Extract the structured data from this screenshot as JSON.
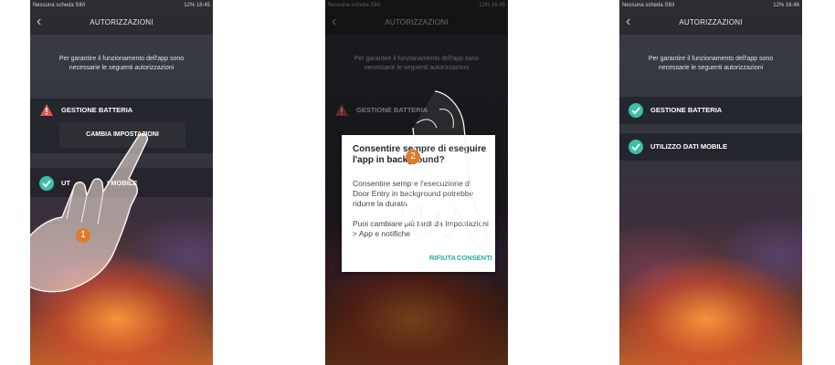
{
  "status_bar": {
    "left": "Nessuna scheda SIM",
    "right": "12%   16:45",
    "right_alt": "12%   16:46"
  },
  "header": {
    "title": "AUTORIZZAZIONI"
  },
  "intro": "Per garantire il funzionamento dell'app sono necessarie le seguenti autorizzazioni",
  "items": {
    "battery": "GESTIONE BATTERIA",
    "mobile_data": "UTILIZZO DATI MOBILE",
    "mobile_data_partial": "UT",
    "mobile_data_tail": "I MOBILE"
  },
  "change_settings_button": "CAMBIA IMPOSTAZIONI",
  "dialog": {
    "title": "Consentire sempre di eseguire l'app in background?",
    "body": "Consentire sempre l'esecuzione di Door Entry in background potrebbe ridurre la durata",
    "note": "Puoi cambiare più tardi da Impostazioni > App e notifiche",
    "deny": "RIFIUTA",
    "allow": "CONSENTI"
  },
  "steps": {
    "one": "1",
    "two": "2"
  },
  "colors": {
    "warning": "#e05a4f",
    "success": "#3bbfa8",
    "accent": "#2aa89a",
    "step_badge": "#e07b2e"
  }
}
